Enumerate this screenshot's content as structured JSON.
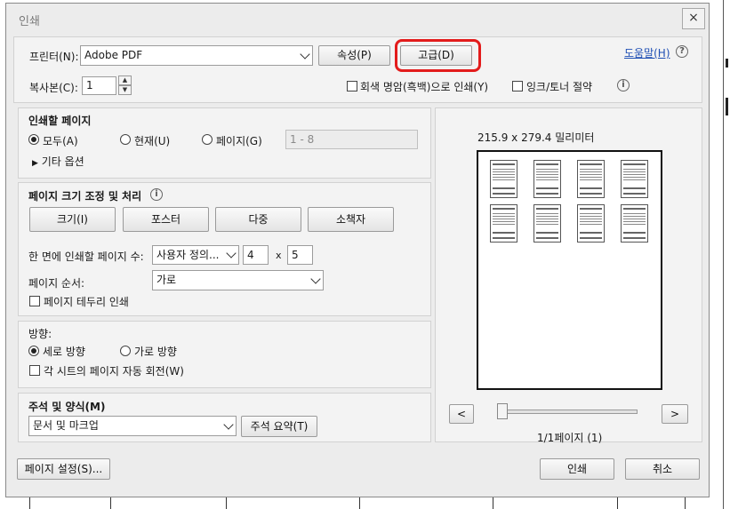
{
  "dialog": {
    "title": "인쇄",
    "close_icon": "×"
  },
  "printer": {
    "label": "프린터(N):",
    "value": "Adobe PDF",
    "properties_button": "속성(P)",
    "advanced_button": "고급(D)",
    "help_link": "도움말(H)",
    "help_icon": "?"
  },
  "copies": {
    "label": "복사본(C):",
    "value": "1",
    "grayscale_label": "회색 명암(흑백)으로 인쇄(Y)",
    "save_ink_label": "잉크/토너 절약",
    "info_icon": "i"
  },
  "pages_to_print": {
    "heading": "인쇄할 페이지",
    "all": "모두(A)",
    "current": "현재(U)",
    "pages": "페이지(G)",
    "pages_range_placeholder": "1 - 8",
    "more_options": "기타 옵션",
    "selected": "all"
  },
  "sizing": {
    "heading": "페이지 크기 조정 및 처리",
    "info_icon": "i",
    "size_button": "크기(I)",
    "poster_button": "포스터",
    "multiple_button": "다중",
    "booklet_button": "소책자",
    "pages_per_sheet_label": "한 면에 인쇄할 페이지 수:",
    "pages_per_sheet_value": "사용자 정의...",
    "cols_value": "4",
    "x_label": "x",
    "rows_value": "5",
    "page_order_label": "페이지 순서:",
    "page_order_value": "가로",
    "print_borders_label": "페이지 테두리 인쇄"
  },
  "orientation": {
    "heading": "방향:",
    "portrait": "세로 방향",
    "landscape": "가로 방향",
    "auto_rotate": "각 시트의 페이지 자동 회전(W)",
    "selected": "portrait"
  },
  "comments": {
    "heading": "주석 및 양식(M)",
    "value": "문서 및 마크업",
    "summary_button": "주석 요약(T)"
  },
  "preview": {
    "size_text": "215.9 x 279.4 밀리미터",
    "prev_button": "<",
    "next_button": ">",
    "page_indicator": "1/1페이지 (1)"
  },
  "footer": {
    "page_setup_button": "페이지 설정(S)...",
    "print_button": "인쇄",
    "cancel_button": "취소"
  }
}
